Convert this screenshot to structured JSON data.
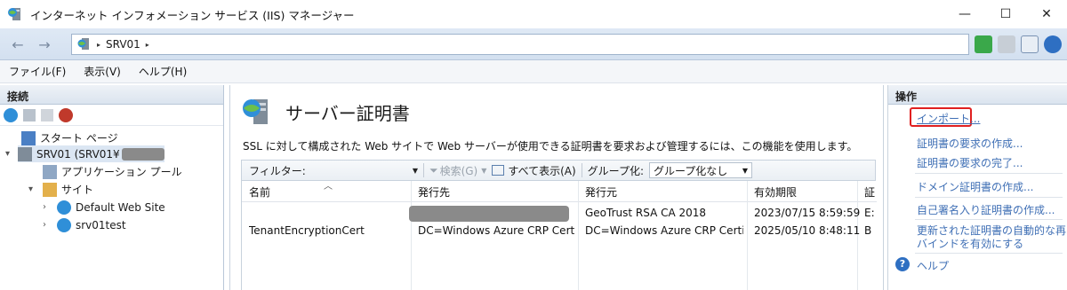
{
  "window": {
    "title": "インターネット インフォメーション サービス (IIS) マネージャー",
    "minimize": "—",
    "maximize": "☐",
    "close": "✕"
  },
  "address": {
    "crumb": "SRV01",
    "sep": "▸"
  },
  "menu": {
    "file": "ファイル(F)",
    "view": "表示(V)",
    "help": "ヘルプ(H)"
  },
  "connections": {
    "title": "接続",
    "tree": {
      "start_page": "スタート ページ",
      "server": "SRV01 (SRV01¥",
      "app_pools": "アプリケーション プール",
      "sites": "サイト",
      "site1": "Default Web Site",
      "site2": "srv01test"
    }
  },
  "feature": {
    "title": "サーバー証明書",
    "description": "SSL に対して構成された Web サイトで Web サーバーが使用できる証明書を要求および管理するには、この機能を使用します。",
    "filter_label": "フィルター:",
    "search": "検索(G)",
    "show_all": "すべて表示(A)",
    "group_by_label": "グループ化:",
    "group_by_value": "グループ化なし",
    "columns": [
      "名前",
      "発行先",
      "発行元",
      "有効期限",
      "証"
    ],
    "rows": [
      {
        "name": "",
        "issued_to": "",
        "issued_by": "GeoTrust RSA CA 2018",
        "expires": "2023/07/15 8:59:59",
        "store": "E:"
      },
      {
        "name": "TenantEncryptionCert",
        "issued_to": "DC=Windows Azure CRP Certi...",
        "issued_by": "DC=Windows Azure CRP Certi...",
        "expires": "2025/05/10 8:48:11",
        "store": "B"
      }
    ]
  },
  "actions": {
    "title": "操作",
    "import": "インポート...",
    "create_request": "証明書の要求の作成...",
    "complete_request": "証明書の要求の完了...",
    "create_domain": "ドメイン証明書の作成...",
    "create_self_signed": "自己署名入り証明書の作成...",
    "enable_auto_rebind_1": "更新された証明書の自動的な再",
    "enable_auto_rebind_2": "バインドを有効にする",
    "help": "ヘルプ"
  }
}
